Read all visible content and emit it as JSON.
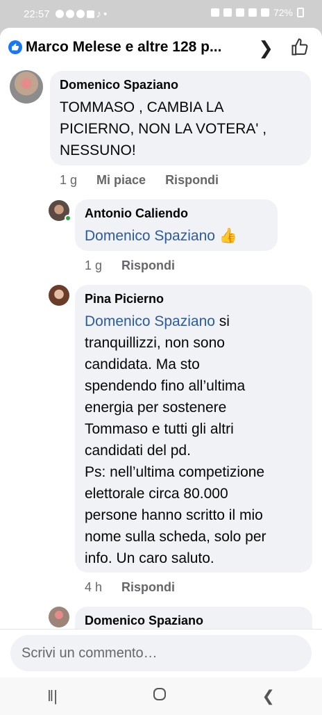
{
  "status_bar": {
    "time": "22:57",
    "battery": "72%"
  },
  "header": {
    "title": "Marco Melese e altre 128 p..."
  },
  "comments": [
    {
      "author": "Domenico Spaziano",
      "text": "TOMMASO , CAMBIA LA PICIERNO, NON LA VOTERA' , NESSUNO!",
      "time": "1 g",
      "like_label": "Mi piace",
      "reply_label": "Rispondi"
    },
    {
      "author": "Antonio Caliendo",
      "mention": "Domenico Spaziano",
      "emoji": "👍",
      "time": "1 g",
      "reply_label": "Rispondi"
    },
    {
      "author": "Pina Picierno",
      "mention": "Domenico Spaziano",
      "text_first": " si",
      "text_lines": [
        "tranquillizzi, non sono",
        "candidata. Ma sto",
        "spendendo fino all’ultima",
        "energia per sostenere",
        "Tommaso e tutti gli altri",
        "candidati del pd.",
        "Ps: nell’ultima competizione",
        "elettorale circa 80.000",
        "persone hanno scritto il mio",
        "nome sulla scheda, solo per",
        "info. Un caro saluto."
      ],
      "time": "4 h",
      "reply_label": "Rispondi"
    },
    {
      "author": "Domenico Spaziano"
    }
  ],
  "composer": {
    "placeholder": "Scrivi un commento…"
  },
  "colors": {
    "accent": "#1877f2",
    "mention": "#2c5aa0",
    "bubble": "#f0f2f5"
  }
}
